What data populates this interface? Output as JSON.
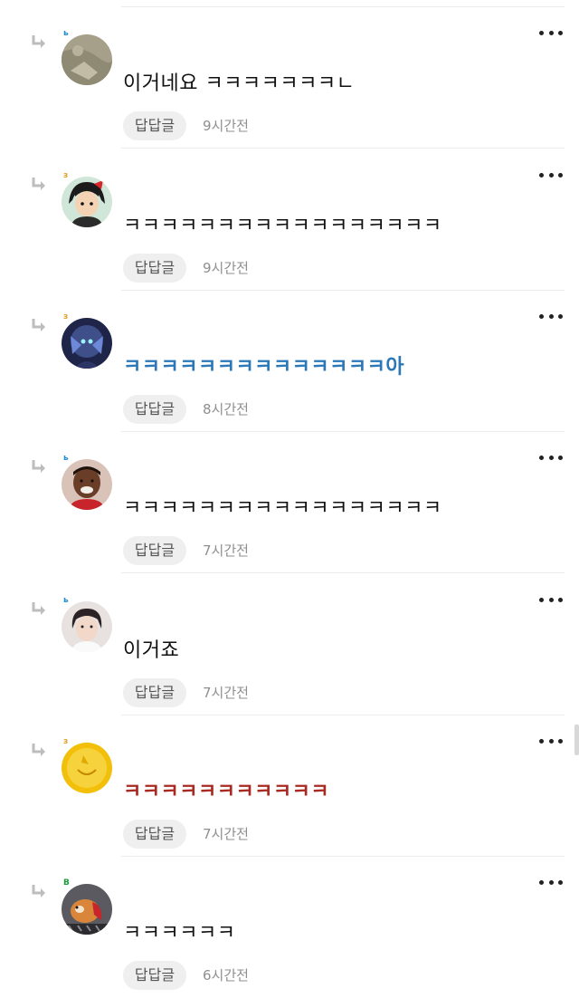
{
  "comments": [
    {
      "level": "ь",
      "level_color": "#1e8fd6",
      "avatar": "stone-wall-avatar",
      "text": "이거네요 ㅋㅋㅋㅋㅋㅋㅋㄴ",
      "text_color": "#111111",
      "reply_label": "답답글",
      "time": "9시간전"
    },
    {
      "level": "з",
      "level_color": "#e0a020",
      "avatar": "anime-girl-avatar",
      "text": "ㅋㅋㅋㅋㅋㅋㅋㅋㅋㅋㅋㅋㅋㅋㅋㅋㅋ",
      "text_color": "#111111",
      "reply_label": "답답글",
      "time": "9시간전"
    },
    {
      "level": "з",
      "level_color": "#e0a020",
      "avatar": "game-character-avatar",
      "text": "ㅋㅋㅋㅋㅋㅋㅋㅋㅋㅋㅋㅋㅋㅋ아",
      "text_color": "#2a78b8",
      "reply_label": "답답글",
      "time": "8시간전"
    },
    {
      "level": "ь",
      "level_color": "#1e8fd6",
      "avatar": "man-face-avatar",
      "text": "ㅋㅋㅋㅋㅋㅋㅋㅋㅋㅋㅋㅋㅋㅋㅋㅋㅋ",
      "text_color": "#111111",
      "reply_label": "답답글",
      "time": "7시간전"
    },
    {
      "level": "ь",
      "level_color": "#1e8fd6",
      "avatar": "person-portrait-avatar",
      "text": "이거죠",
      "text_color": "#111111",
      "reply_label": "답답글",
      "time": "7시간전"
    },
    {
      "level": "з",
      "level_color": "#e0a020",
      "avatar": "yellow-sun-avatar",
      "text": "ㅋㅋㅋㅋㅋㅋㅋㅋㅋㅋㅋ",
      "text_color": "#a82a22",
      "reply_label": "답답글",
      "time": "7시간전"
    },
    {
      "level": "В",
      "level_color": "#1a9a3a",
      "avatar": "dog-avatar",
      "text": "ㅋㅋㅋㅋㅋㅋ",
      "text_color": "#111111",
      "reply_label": "답답글",
      "time": "6시간전"
    }
  ]
}
